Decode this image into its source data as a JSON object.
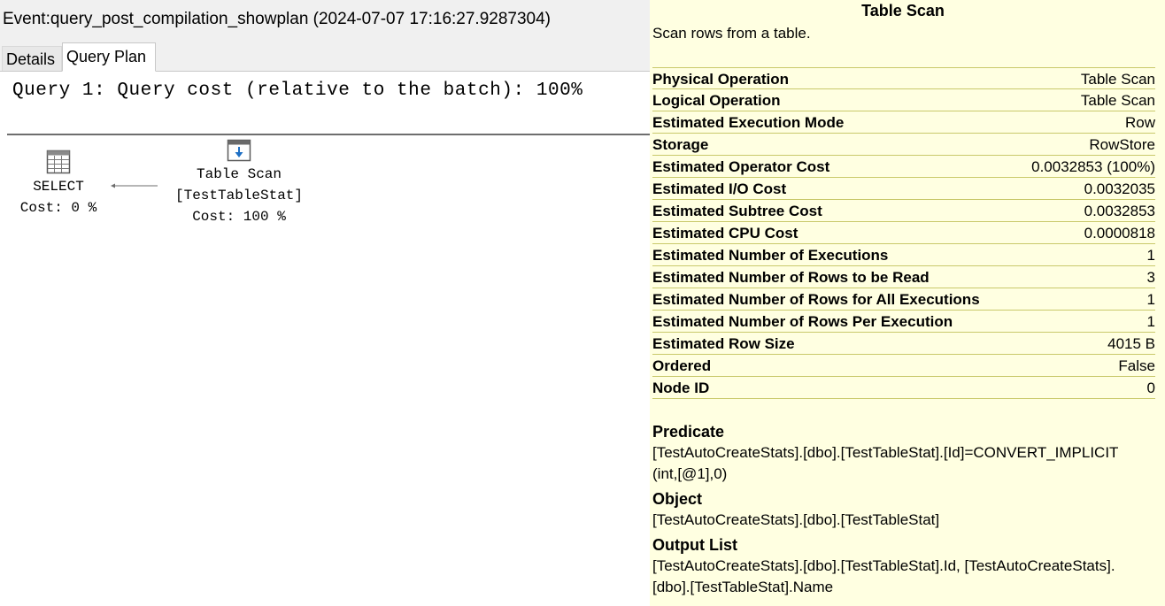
{
  "event_title": "Event:query_post_compilation_showplan (2024-07-07 17:16:27.9287304)",
  "tabs": [
    {
      "label": "Details",
      "active": false
    },
    {
      "label": "Query Plan",
      "active": true
    }
  ],
  "plan": {
    "query_cost": "Query 1: Query cost (relative to the batch): 100%",
    "nodes": {
      "select": {
        "icon": "select-result-icon",
        "name": "SELECT",
        "cost": "Cost: 0 %"
      },
      "scan": {
        "icon": "table-scan-icon",
        "name": "Table Scan",
        "object": "[TestTableStat]",
        "cost": "Cost: 100 %"
      }
    }
  },
  "tooltip": {
    "title": "Table Scan",
    "description": "Scan rows from a table.",
    "properties": [
      {
        "name": "Physical Operation",
        "value": "Table Scan"
      },
      {
        "name": "Logical Operation",
        "value": "Table Scan"
      },
      {
        "name": "Estimated Execution Mode",
        "value": "Row"
      },
      {
        "name": "Storage",
        "value": "RowStore"
      },
      {
        "name": "Estimated Operator Cost",
        "value": "0.0032853 (100%)"
      },
      {
        "name": "Estimated I/O Cost",
        "value": "0.0032035"
      },
      {
        "name": "Estimated Subtree Cost",
        "value": "0.0032853"
      },
      {
        "name": "Estimated CPU Cost",
        "value": "0.0000818"
      },
      {
        "name": "Estimated Number of Executions",
        "value": "1"
      },
      {
        "name": "Estimated Number of Rows to be Read",
        "value": "3"
      },
      {
        "name": "Estimated Number of Rows for All Executions",
        "value": "1"
      },
      {
        "name": "Estimated Number of Rows Per Execution",
        "value": "1"
      },
      {
        "name": "Estimated Row Size",
        "value": "4015 B"
      },
      {
        "name": "Ordered",
        "value": "False"
      },
      {
        "name": "Node ID",
        "value": "0"
      }
    ],
    "predicate": {
      "label": "Predicate",
      "line1": "[TestAutoCreateStats].[dbo].[TestTableStat].[Id]=CONVERT_IMPLICIT",
      "line2": "(int,[@1],0)"
    },
    "object": {
      "label": "Object",
      "text": "[TestAutoCreateStats].[dbo].[TestTableStat]"
    },
    "output_list": {
      "label": "Output List",
      "line1": "[TestAutoCreateStats].[dbo].[TestTableStat].Id,  [TestAutoCreateStats].",
      "line2": "[dbo].[TestTableStat].Name"
    }
  },
  "colors": {
    "tooltip_background": "#ffffe1",
    "tooltip_row_border": "#c9c96b",
    "header_background": "#f0f0f0",
    "icon_blue": "#1e6fc4"
  }
}
